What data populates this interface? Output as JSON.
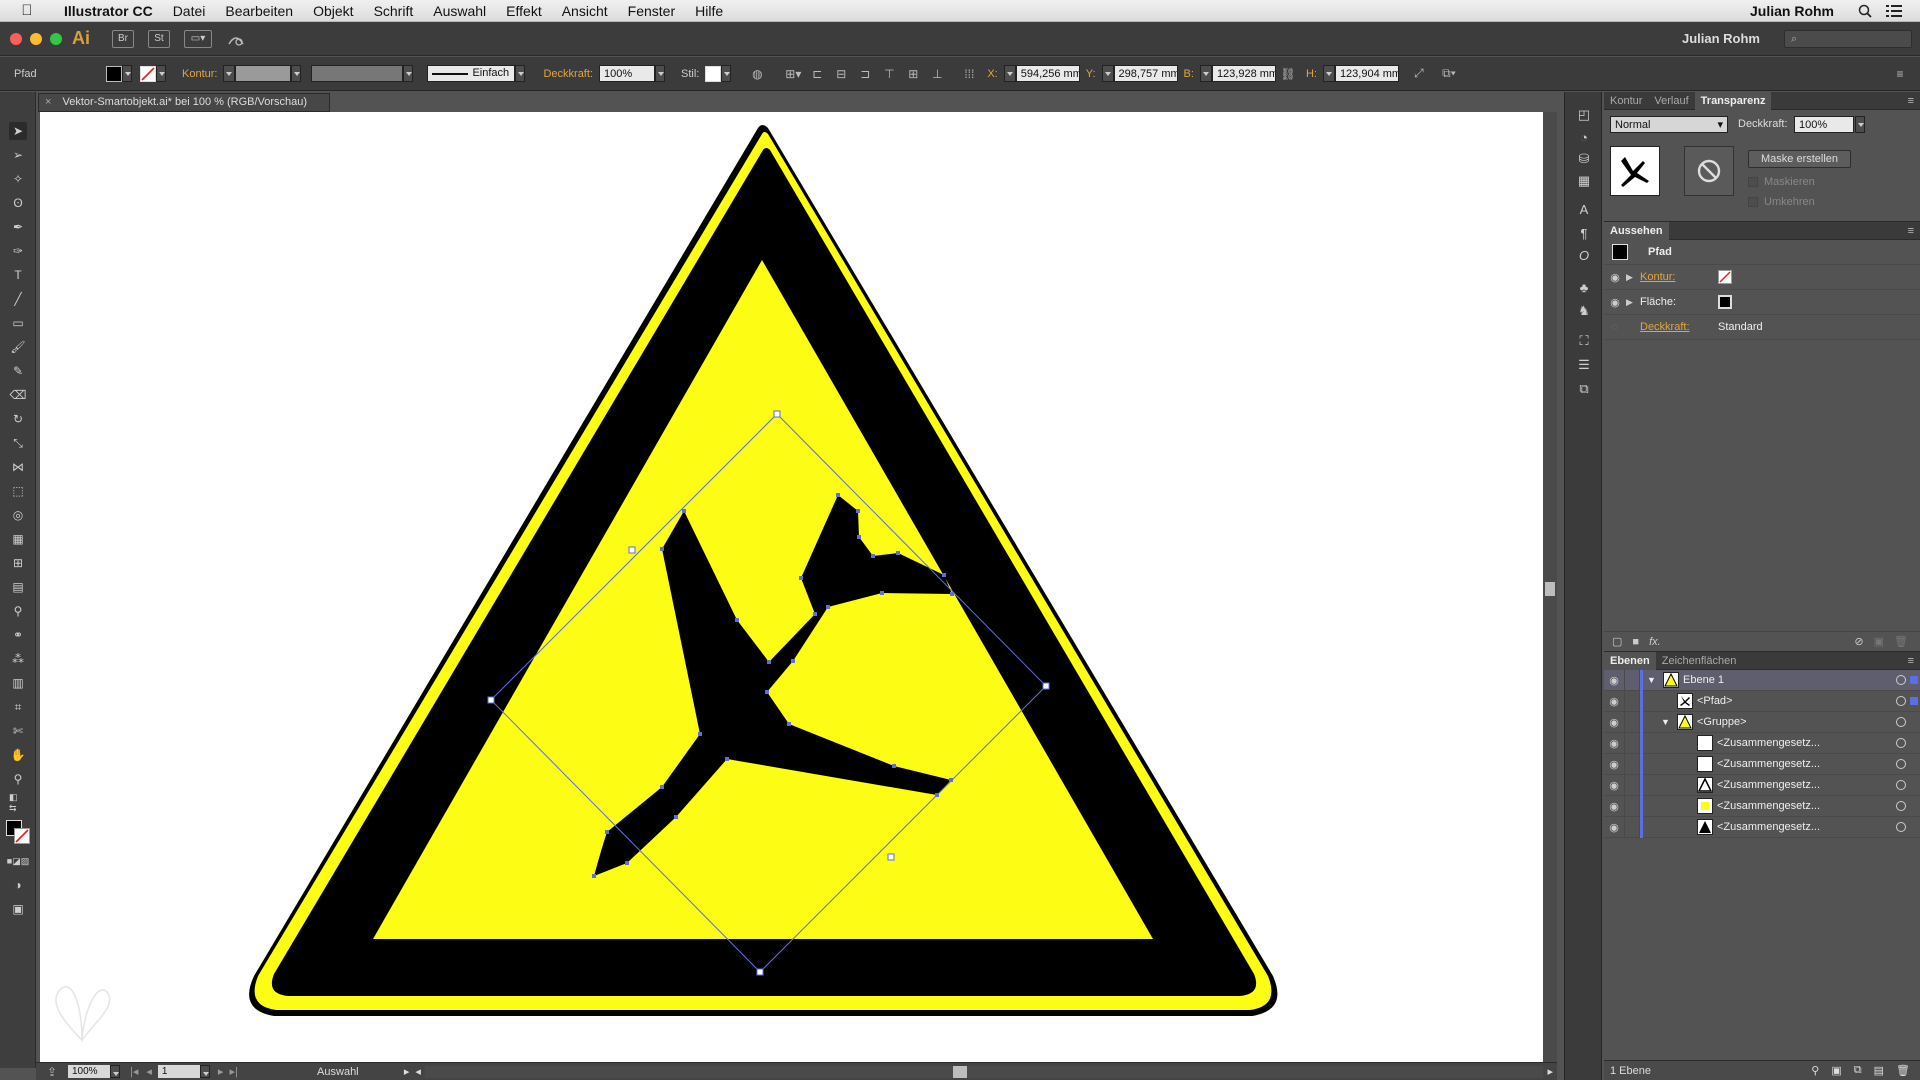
{
  "menubar": {
    "app_name": "Illustrator CC",
    "items": [
      "Datei",
      "Bearbeiten",
      "Objekt",
      "Schrift",
      "Auswahl",
      "Effekt",
      "Ansicht",
      "Fenster",
      "Hilfe"
    ],
    "user": "Julian Rohm"
  },
  "appbar": {
    "logo": "Ai",
    "bridge": "Br",
    "stock": "St",
    "workspace_user": "Julian Rohm",
    "traffic_colors": [
      "#fc5f57",
      "#fdbc2e",
      "#33c748"
    ]
  },
  "controlbar": {
    "selection_type": "Pfad",
    "kontur_label": "Kontur:",
    "stroke_style": "Einfach",
    "deckkraft_label": "Deckkraft:",
    "deckkraft_value": "100%",
    "stil_label": "Stil:",
    "x_label": "X:",
    "x_value": "594,256 mm",
    "y_label": "Y:",
    "y_value": "298,757 mm",
    "b_label": "B:",
    "b_value": "123,928 mm",
    "h_label": "H:",
    "h_value": "123,904 mm"
  },
  "document": {
    "tab_title": "Vektor-Smartobjekt.ai* bei 100 % (RGB/Vorschau)"
  },
  "statusbar": {
    "zoom": "100%",
    "artboard": "1",
    "tool_name": "Auswahl"
  },
  "transparency_panel": {
    "tabs": [
      "Kontur",
      "Verlauf",
      "Transparenz"
    ],
    "active_tab": "Transparenz",
    "blend_mode": "Normal",
    "deckkraft_label": "Deckkraft:",
    "deckkraft_value": "100%",
    "mask_button": "Maske erstellen",
    "clip_label": "Maskieren",
    "invert_label": "Umkehren"
  },
  "appearance_panel": {
    "title": "Aussehen",
    "object_type": "Pfad",
    "rows": [
      {
        "label": "Kontur:",
        "value": ""
      },
      {
        "label": "Fläche:",
        "value": ""
      },
      {
        "label": "Deckkraft:",
        "value": "Standard"
      }
    ]
  },
  "layers_panel": {
    "tabs": [
      "Ebenen",
      "Zeichenflächen"
    ],
    "active_tab": "Ebenen",
    "layers": [
      {
        "name": "Ebene 1",
        "indent": 0,
        "expanded": true
      },
      {
        "name": "<Pfad>",
        "indent": 1,
        "expanded": false
      },
      {
        "name": "<Gruppe>",
        "indent": 1,
        "expanded": true
      },
      {
        "name": "<Zusammengesetz...",
        "indent": 2,
        "expanded": false
      },
      {
        "name": "<Zusammengesetz...",
        "indent": 2,
        "expanded": false
      },
      {
        "name": "<Zusammengesetz...",
        "indent": 2,
        "expanded": false
      },
      {
        "name": "<Zusammengesetz...",
        "indent": 2,
        "expanded": false
      },
      {
        "name": "<Zusammengesetz...",
        "indent": 2,
        "expanded": false
      }
    ],
    "footer": "1 Ebene"
  },
  "colors": {
    "warning_yellow": "#fcfc14",
    "selection_blue": "#5c6ee0",
    "accent_orange": "#e3a63a",
    "black": "#000000"
  }
}
